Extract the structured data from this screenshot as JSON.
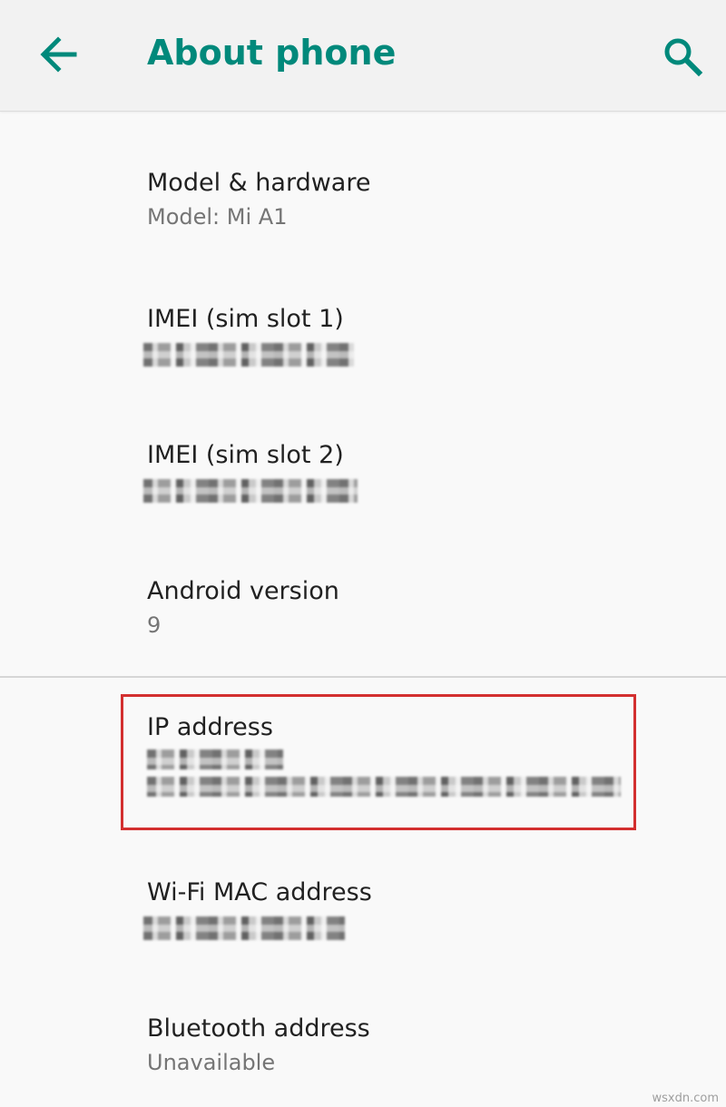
{
  "header": {
    "title": "About phone",
    "back_icon": "arrow-left-icon",
    "search_icon": "search-icon",
    "accent_color": "#00897b"
  },
  "items": [
    {
      "title": "Model & hardware",
      "subtitle": "Model: Mi A1"
    },
    {
      "title": "IMEI (sim slot 1)"
    },
    {
      "title": "IMEI (sim slot 2)"
    },
    {
      "title": "Android version",
      "subtitle": "9"
    },
    {
      "title": "IP address"
    },
    {
      "title": "Wi-Fi MAC address"
    },
    {
      "title": "Bluetooth address",
      "subtitle": "Unavailable"
    }
  ],
  "highlight_color": "#d32f2f",
  "watermark": "wsxdn.com"
}
